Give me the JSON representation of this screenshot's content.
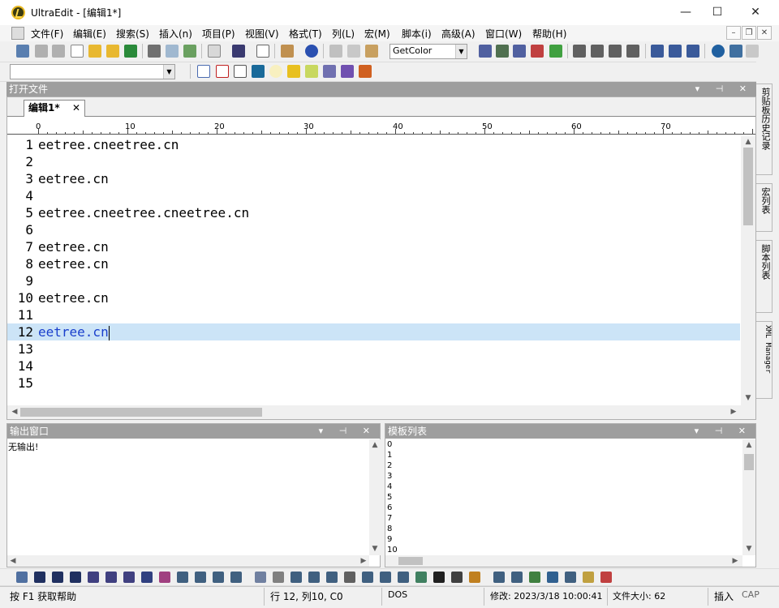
{
  "window": {
    "title": "UltraEdit - [编辑1*]",
    "minimize_glyph": "—",
    "maximize_glyph": "☐",
    "close_glyph": "✕"
  },
  "menu": {
    "items": [
      "文件(F)",
      "编辑(E)",
      "搜索(S)",
      "插入(n)",
      "项目(P)",
      "视图(V)",
      "格式(T)",
      "列(L)",
      "宏(M)",
      "脚本(i)",
      "高级(A)",
      "窗口(W)",
      "帮助(H)"
    ],
    "mdi_minimize": "–",
    "mdi_restore": "❐",
    "mdi_close": "✕"
  },
  "toolbar": {
    "macro_combo_value": "GetColor",
    "find_combo_value": ""
  },
  "open_files_panel": {
    "title": "打开文件",
    "controls": "▾ ⊣ ✕"
  },
  "editor": {
    "tab_label": "编辑1*",
    "tab_close": "✕",
    "ruler_labels": [
      "0",
      "10",
      "20",
      "30",
      "40",
      "50",
      "60",
      "70"
    ],
    "lines": [
      {
        "num": "1",
        "text": "eetree.cneetree.cn"
      },
      {
        "num": "2",
        "text": ""
      },
      {
        "num": "3",
        "text": "eetree.cn"
      },
      {
        "num": "4",
        "text": ""
      },
      {
        "num": "5",
        "text": "eetree.cneetree.cneetree.cn"
      },
      {
        "num": "6",
        "text": ""
      },
      {
        "num": "7",
        "text": "eetree.cn"
      },
      {
        "num": "8",
        "text": "eetree.cn"
      },
      {
        "num": "9",
        "text": ""
      },
      {
        "num": "10",
        "text": "eetree.cn"
      },
      {
        "num": "11",
        "text": ""
      },
      {
        "num": "12",
        "text": "eetree.cn"
      },
      {
        "num": "13",
        "text": ""
      },
      {
        "num": "14",
        "text": ""
      },
      {
        "num": "15",
        "text": ""
      }
    ],
    "current_line": 12
  },
  "side_tabs": [
    "剪贴板历史记录",
    "宏列表",
    "脚本列表",
    "XML Manager"
  ],
  "output_panel": {
    "title": "输出窗口",
    "content": "无输出!"
  },
  "template_panel": {
    "title": "模板列表",
    "items": [
      "0",
      "1",
      "2",
      "3",
      "4",
      "5",
      "6",
      "7",
      "8",
      "9",
      "10"
    ]
  },
  "status": {
    "help": "按 F1 获取帮助",
    "position": "行 12, 列10, C0",
    "line_ending": "DOS",
    "modified": "修改:   2023/3/18 10:00:41",
    "file_size": "文件大小:  62",
    "insert_mode": "插入",
    "caps": "CAP"
  }
}
